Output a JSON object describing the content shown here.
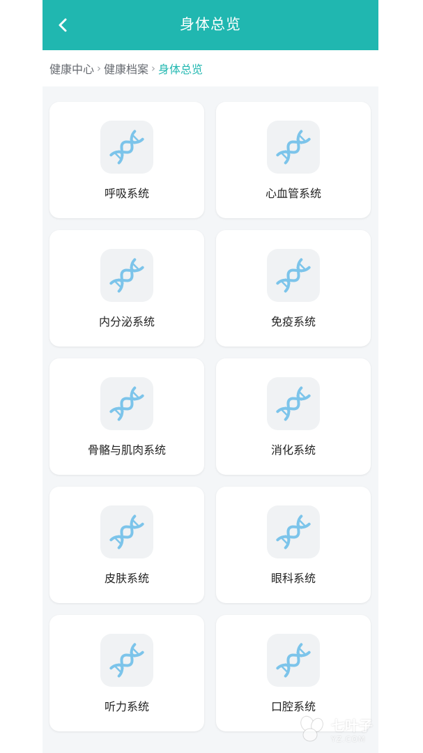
{
  "header": {
    "title": "身体总览",
    "background_color": "#20b7b0",
    "back_icon": "chevron-left-icon"
  },
  "breadcrumb": {
    "items": [
      "健康中心",
      "健康档案",
      "身体总览"
    ],
    "separator": "›",
    "current_color": "#20b7b0"
  },
  "systems": [
    {
      "label": "呼吸系统",
      "icon": "dna-icon"
    },
    {
      "label": "心血管系统",
      "icon": "dna-icon"
    },
    {
      "label": "内分泌系统",
      "icon": "dna-icon"
    },
    {
      "label": "免疫系统",
      "icon": "dna-icon"
    },
    {
      "label": "骨骼与肌肉系统",
      "icon": "dna-icon"
    },
    {
      "label": "消化系统",
      "icon": "dna-icon"
    },
    {
      "label": "皮肤系统",
      "icon": "dna-icon"
    },
    {
      "label": "眼科系统",
      "icon": "dna-icon"
    },
    {
      "label": "听力系统",
      "icon": "dna-icon"
    },
    {
      "label": "口腔系统",
      "icon": "dna-icon"
    }
  ],
  "watermark": {
    "name": "七叶子",
    "url": "YZ.COM"
  },
  "colors": {
    "dna_icon": "#7cc4ea",
    "page_background": "#f4f6f8"
  }
}
